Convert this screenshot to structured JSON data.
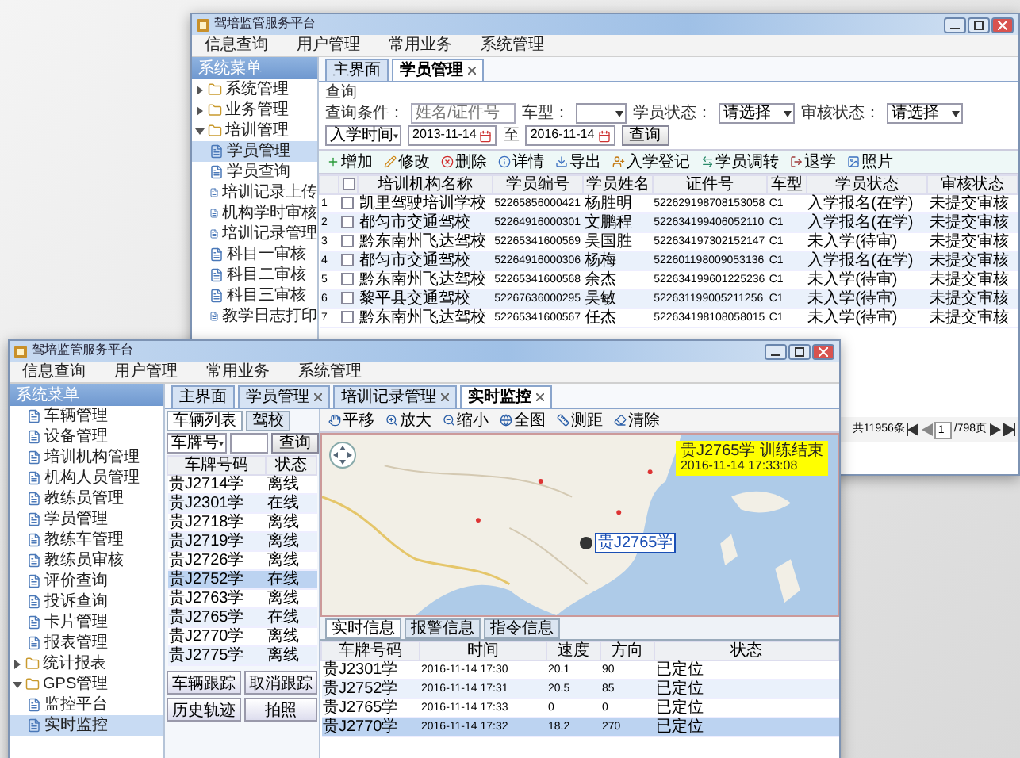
{
  "background_window": {
    "title": "驾培监管服务平台",
    "menu": [
      "信息查询",
      "用户管理",
      "常用业务",
      "系统管理"
    ],
    "sidebar": {
      "header": "系统菜单",
      "tree": [
        {
          "label": "系统管理",
          "expanded": false
        },
        {
          "label": "业务管理",
          "expanded": false
        },
        {
          "label": "培训管理",
          "expanded": true,
          "children": [
            {
              "label": "学员管理",
              "selected": true
            },
            {
              "label": "学员查询",
              "selected": false
            },
            {
              "label": "培训记录上传",
              "selected": false
            },
            {
              "label": "机构学时审核",
              "selected": false
            },
            {
              "label": "培训记录管理",
              "selected": false
            },
            {
              "label": "科目一审核",
              "selected": false
            },
            {
              "label": "科目二审核",
              "selected": false
            },
            {
              "label": "科目三审核",
              "selected": false
            },
            {
              "label": "教学日志打印",
              "selected": false
            }
          ]
        }
      ]
    },
    "tabs": [
      {
        "label": "主界面",
        "selected": false
      },
      {
        "label": "学员管理",
        "selected": true
      }
    ],
    "query": {
      "title": "查询",
      "fields": [
        {
          "kind": "text",
          "label": "查询条件：",
          "placeholder": "姓名/证件号"
        },
        {
          "kind": "select",
          "label": "车型："
        },
        {
          "kind": "select",
          "label": "学员状态：",
          "value": "请选择"
        },
        {
          "kind": "select",
          "label": "审核状态：",
          "value": "请选择"
        },
        {
          "kind": "select",
          "value": "入学时间"
        }
      ],
      "date_from": "2013-11-14",
      "separator": "至",
      "date_to": "2016-11-14",
      "search_button": "查询"
    },
    "toolbar": [
      "增加",
      "修改",
      "删除",
      "详情",
      "导出",
      "入学登记",
      "学员调转",
      "退学",
      "照片"
    ],
    "table": {
      "select_all_checked": false,
      "columns": [
        "培训机构名称",
        "学员编号",
        "学员姓名",
        "证件号",
        "车型",
        "学员状态",
        "审核状态"
      ],
      "rows": [
        {
          "number": "1",
          "checked": false,
          "cells": [
            "凯里驾驶培训学校",
            "52265856000421",
            "杨胜明",
            "522629198708153058",
            "C1",
            "入学报名(在学)",
            "未提交审核"
          ]
        },
        {
          "number": "2",
          "checked": false,
          "cells": [
            "都匀市交通驾校",
            "52264916000301",
            "文鹏程",
            "522634199406052110",
            "C1",
            "入学报名(在学)",
            "未提交审核"
          ]
        },
        {
          "number": "3",
          "checked": false,
          "cells": [
            "黔东南州飞达驾校",
            "52265341600569",
            "吴国胜",
            "522634197302152147",
            "C1",
            "未入学(待审)",
            "未提交审核"
          ]
        },
        {
          "number": "4",
          "checked": false,
          "cells": [
            "都匀市交通驾校",
            "52264916000306",
            "杨梅",
            "522601198009053136",
            "C1",
            "入学报名(在学)",
            "未提交审核"
          ]
        },
        {
          "number": "5",
          "checked": false,
          "cells": [
            "黔东南州飞达驾校",
            "52265341600568",
            "余杰",
            "522634199601225236",
            "C1",
            "未入学(待审)",
            "未提交审核"
          ]
        },
        {
          "number": "6",
          "checked": false,
          "cells": [
            "黎平县交通驾校",
            "52267636000295",
            "吴敏",
            "522631199005211256",
            "C1",
            "未入学(待审)",
            "未提交审核"
          ]
        },
        {
          "number": "7",
          "checked": false,
          "cells": [
            "黔东南州飞达驾校",
            "52265341600567",
            "任杰",
            "522634198108058015",
            "C1",
            "未入学(待审)",
            "未提交审核"
          ]
        }
      ]
    },
    "pager": {
      "total": "共11956条",
      "page": "1",
      "pages": "/798页"
    }
  },
  "front_window": {
    "title": "驾培监管服务平台",
    "menu": [
      "信息查询",
      "用户管理",
      "常用业务",
      "系统管理"
    ],
    "sidebar": {
      "header": "系统菜单",
      "tree": [
        {
          "children": [
            {
              "label": "车辆管理",
              "selected": false
            },
            {
              "label": "设备管理",
              "selected": false
            },
            {
              "label": "培训机构管理",
              "selected": false
            },
            {
              "label": "机构人员管理",
              "selected": false
            },
            {
              "label": "教练员管理",
              "selected": false
            },
            {
              "label": "学员管理",
              "selected": false
            },
            {
              "label": "教练车管理",
              "selected": false
            },
            {
              "label": "教练员审核",
              "selected": false
            },
            {
              "label": "评价查询",
              "selected": false
            },
            {
              "label": "投诉查询",
              "selected": false
            },
            {
              "label": "卡片管理",
              "selected": false
            },
            {
              "label": "报表管理",
              "selected": false
            }
          ]
        },
        {
          "label": "统计报表",
          "expanded": false
        },
        {
          "label": "GPS管理",
          "expanded": true,
          "children": [
            {
              "label": "监控平台",
              "selected": false
            },
            {
              "label": "实时监控",
              "selected": true
            }
          ]
        }
      ]
    },
    "tabs": [
      {
        "label": "主界面",
        "selected": false
      },
      {
        "label": "学员管理",
        "selected": false
      },
      {
        "label": "培训记录管理",
        "selected": false
      },
      {
        "label": "实时监控",
        "selected": true
      }
    ],
    "vehicle_panel": {
      "tabs": [
        {
          "label": "车辆列表",
          "selected": true
        },
        {
          "label": "驾校",
          "selected": false
        }
      ],
      "filter": "车牌号",
      "search_button": "查询",
      "columns": [
        "车牌号码",
        "状态"
      ],
      "rows": [
        {
          "plate": "贵J2714学",
          "status": "离线",
          "selected": false
        },
        {
          "plate": "贵J2301学",
          "status": "在线",
          "selected": false
        },
        {
          "plate": "贵J2718学",
          "status": "离线",
          "selected": false
        },
        {
          "plate": "贵J2719学",
          "status": "离线",
          "selected": false
        },
        {
          "plate": "贵J2726学",
          "status": "离线",
          "selected": false
        },
        {
          "plate": "贵J2752学",
          "status": "在线",
          "selected": true
        },
        {
          "plate": "贵J2763学",
          "status": "离线",
          "selected": false
        },
        {
          "plate": "贵J2765学",
          "status": "在线",
          "selected": false
        },
        {
          "plate": "贵J2770学",
          "status": "离线",
          "selected": false
        },
        {
          "plate": "贵J2775学",
          "status": "离线",
          "selected": false
        }
      ],
      "buttons": [
        "车辆跟踪",
        "取消跟踪",
        "历史轨迹",
        "拍照"
      ]
    },
    "map": {
      "toolbar": [
        "平移",
        "放大",
        "缩小",
        "全图",
        "测距",
        "清除"
      ],
      "vehicle_label": "贵J2765学",
      "popup": {
        "title": "贵J2765学 训练结束",
        "time": "2016-11-14 17:33:08"
      }
    },
    "monitor": {
      "tabs": [
        {
          "label": "实时信息",
          "selected": true
        },
        {
          "label": "报警信息",
          "selected": false
        },
        {
          "label": "指令信息",
          "selected": false
        }
      ],
      "columns": [
        "车牌号码",
        "时间",
        "速度",
        "方向",
        "状态"
      ],
      "rows": [
        {
          "cells": [
            "贵J2301学",
            "2016-11-14 17:30",
            "20.1",
            "90",
            "已定位"
          ],
          "selected": false
        },
        {
          "cells": [
            "贵J2752学",
            "2016-11-14 17:31",
            "20.5",
            "85",
            "已定位"
          ],
          "selected": false
        },
        {
          "cells": [
            "贵J2765学",
            "2016-11-14 17:33",
            "0",
            "0",
            "已定位"
          ],
          "selected": false
        },
        {
          "cells": [
            "贵J2770学",
            "2016-11-14 17:32",
            "18.2",
            "270",
            "已定位"
          ],
          "selected": true
        }
      ]
    }
  }
}
